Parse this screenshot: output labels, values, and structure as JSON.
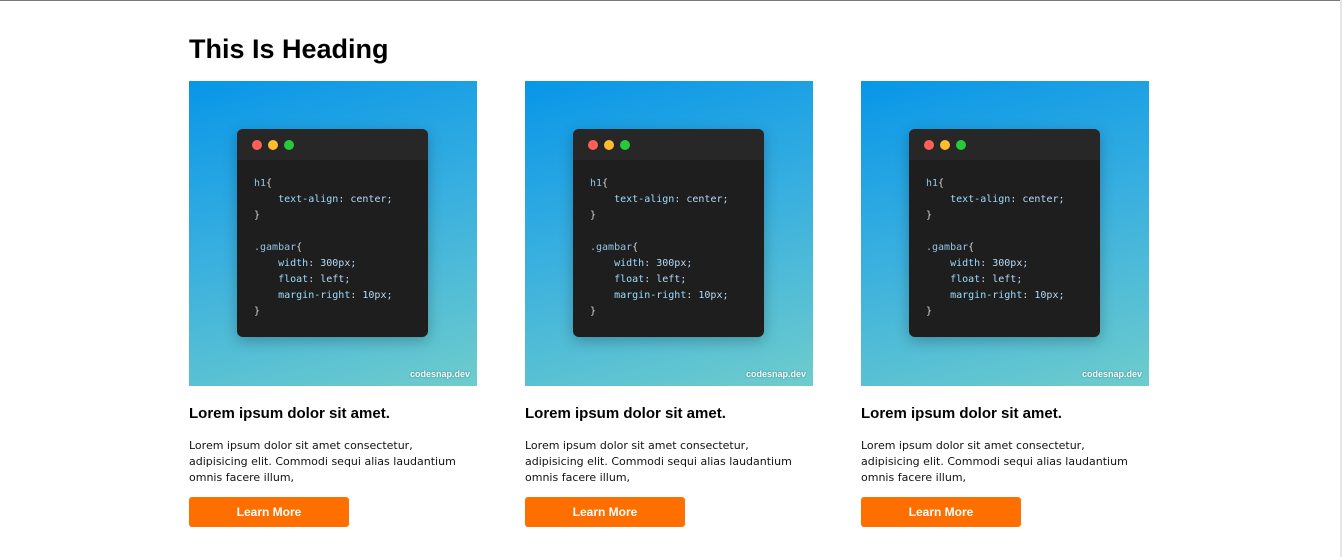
{
  "page": {
    "heading": "This Is Heading"
  },
  "cards": [
    {
      "title": "Lorem ipsum dolor sit amet.",
      "text": "Lorem ipsum dolor sit amet consectetur, adipisicing elit. Commodi sequi alias laudantium omnis facere illum,",
      "button_label": "Learn More",
      "code": "h1{\n    text-align: center;\n}\n\n.gambar{\n    width: 300px;\n    float: left;\n    margin-right: 10px;\n}",
      "watermark": "codesnap.dev"
    },
    {
      "title": "Lorem ipsum dolor sit amet.",
      "text": "Lorem ipsum dolor sit amet consectetur, adipisicing elit. Commodi sequi alias laudantium omnis facere illum,",
      "button_label": "Learn More",
      "code": "h1{\n    text-align: center;\n}\n\n.gambar{\n    width: 300px;\n    float: left;\n    margin-right: 10px;\n}",
      "watermark": "codesnap.dev"
    },
    {
      "title": "Lorem ipsum dolor sit amet.",
      "text": "Lorem ipsum dolor sit amet consectetur, adipisicing elit. Commodi sequi alias laudantium omnis facere illum,",
      "button_label": "Learn More",
      "code": "h1{\n    text-align: center;\n}\n\n.gambar{\n    width: 300px;\n    float: left;\n    margin-right: 10px;\n}",
      "watermark": "codesnap.dev"
    }
  ],
  "colors": {
    "button": "#ff6f00",
    "code_background": "#1e1e1e",
    "gradient_top": "#0896e8",
    "gradient_bottom": "#6ecccc"
  }
}
